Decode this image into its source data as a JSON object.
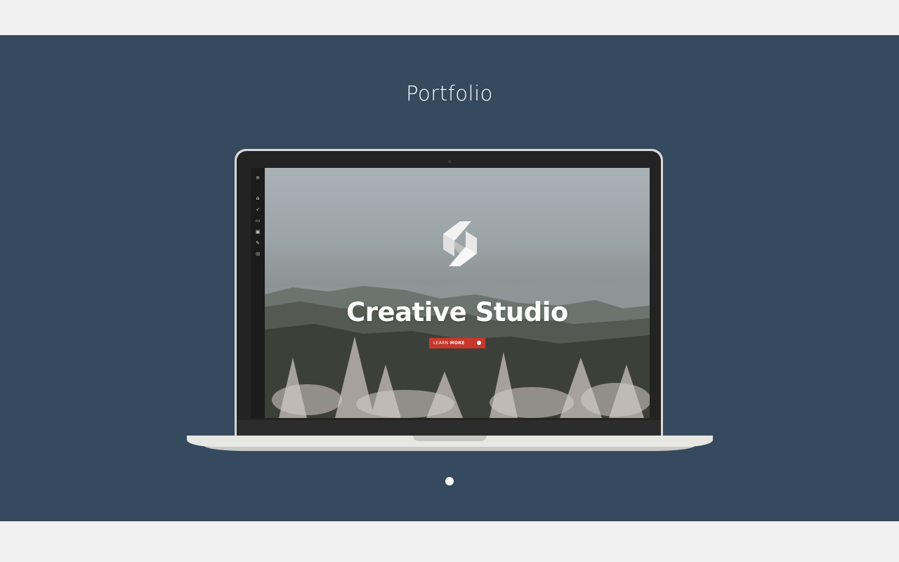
{
  "section": {
    "title": "Portfolio"
  },
  "screen": {
    "hero_title": "Creative Studio",
    "cta": {
      "label_light": "LEARN",
      "label_bold": "MORE"
    },
    "sidebar": {
      "items": [
        {
          "icon": "menu-icon",
          "glyph": "≡"
        },
        {
          "icon": "home-icon",
          "glyph": "⌂"
        },
        {
          "icon": "rocket-icon",
          "glyph": "➶"
        },
        {
          "icon": "laptop-icon",
          "glyph": "▭"
        },
        {
          "icon": "money-icon",
          "glyph": "▣"
        },
        {
          "icon": "pencil-icon",
          "glyph": "✎"
        },
        {
          "icon": "envelope-icon",
          "glyph": "✉"
        }
      ]
    }
  },
  "pagination": {
    "active_index": 0,
    "count": 1
  },
  "colors": {
    "band": "#35495f",
    "page_bg": "#f1f1f1",
    "cta": "#c7372b"
  }
}
